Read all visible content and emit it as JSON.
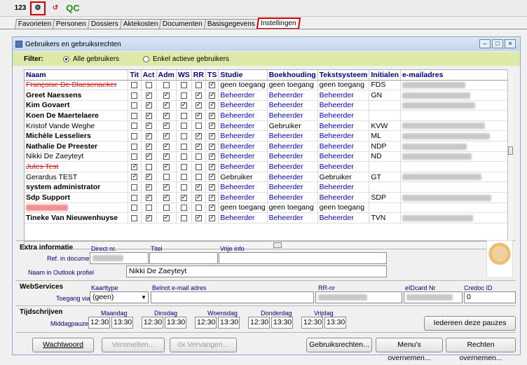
{
  "toolbar": {
    "buttons": [
      {
        "name": "numbering-icon",
        "label": "123"
      },
      {
        "name": "users-settings-icon",
        "label": "⚙"
      },
      {
        "name": "arrow-icon",
        "label": "↺"
      },
      {
        "name": "qc-icon",
        "label": "QC"
      }
    ]
  },
  "tabs": [
    "Favorieten",
    "Personen",
    "Dossiers",
    "Aktekosten",
    "Documenten",
    "Basisgegevens",
    "Instellingen"
  ],
  "window": {
    "title": "Gebruikers en gebruiksrechten"
  },
  "filter": {
    "label": "Filter:",
    "option_all": "Alle gebruikers",
    "option_active": "Enkel actieve gebruikers"
  },
  "table": {
    "headers": [
      "Naam",
      "Tit",
      "Act",
      "Adm",
      "WS",
      "RR",
      "TS",
      "Studie",
      "Boekhouding",
      "Tekstsysteem",
      "Initialen",
      "e-mailadres"
    ],
    "rows": [
      {
        "name": "Françoise De Blaesenaeker",
        "style": "strike",
        "tit": false,
        "act": false,
        "adm": false,
        "ws": false,
        "rr": false,
        "ts": true,
        "studie": "geen toegang",
        "boek": "geen toegang",
        "tekst": "geen toegang",
        "init": "FDS",
        "email": true
      },
      {
        "name": "Greet Naessens",
        "style": "bold",
        "tit": false,
        "act": true,
        "adm": true,
        "ws": false,
        "rr": true,
        "ts": true,
        "studie": "Beheerder",
        "boek": "Beheerder",
        "tekst": "Beheerder",
        "init": "GN",
        "email": true
      },
      {
        "name": "Kim Govaert",
        "style": "bold",
        "tit": false,
        "act": true,
        "adm": true,
        "ws": true,
        "rr": true,
        "ts": true,
        "studie": "Beheerder",
        "boek": "Beheerder",
        "tekst": "Beheerder",
        "init": "",
        "email": true
      },
      {
        "name": "Koen De Maertelaere",
        "style": "bold",
        "tit": false,
        "act": true,
        "adm": true,
        "ws": false,
        "rr": true,
        "ts": true,
        "studie": "Beheerder",
        "boek": "Beheerder",
        "tekst": "Beheerder",
        "init": "",
        "email": false
      },
      {
        "name": "Kristof Vande Weghe",
        "style": "normal",
        "tit": false,
        "act": true,
        "adm": true,
        "ws": false,
        "rr": false,
        "ts": true,
        "studie": "Beheerder",
        "boek": "Gebruiker",
        "tekst": "Beheerder",
        "init": "KVW",
        "email": true
      },
      {
        "name": "Michèle Lesseliers",
        "style": "bold",
        "tit": false,
        "act": true,
        "adm": true,
        "ws": false,
        "rr": true,
        "ts": true,
        "studie": "Beheerder",
        "boek": "Beheerder",
        "tekst": "Beheerder",
        "init": "ML",
        "email": true
      },
      {
        "name": "Nathalie De Preester",
        "style": "bold",
        "tit": false,
        "act": true,
        "adm": true,
        "ws": false,
        "rr": true,
        "ts": true,
        "studie": "Beheerder",
        "boek": "Beheerder",
        "tekst": "Beheerder",
        "init": "NDP",
        "email": true
      },
      {
        "name": "Nikki De Zaeyteyt",
        "style": "normal",
        "tit": false,
        "act": true,
        "adm": true,
        "ws": false,
        "rr": false,
        "ts": true,
        "studie": "Beheerder",
        "boek": "Beheerder",
        "tekst": "Beheerder",
        "init": "ND",
        "email": true
      },
      {
        "name": "Jules Test",
        "style": "strike",
        "tit": true,
        "act": false,
        "adm": true,
        "ws": false,
        "rr": false,
        "ts": true,
        "studie": "Beheerder",
        "boek": "Beheerder",
        "tekst": "Beheerder",
        "init": "",
        "email": false
      },
      {
        "name": "Gerardus TEST",
        "style": "normal",
        "tit": true,
        "act": true,
        "adm": false,
        "ws": false,
        "rr": false,
        "ts": true,
        "studie": "Gebruiker",
        "boek": "Beheerder",
        "tekst": "Gebruiker",
        "init": "GT",
        "email": true
      },
      {
        "name": "system administrator",
        "style": "bold",
        "tit": false,
        "act": true,
        "adm": true,
        "ws": false,
        "rr": true,
        "ts": true,
        "studie": "Beheerder",
        "boek": "Beheerder",
        "tekst": "Beheerder",
        "init": "",
        "email": false
      },
      {
        "name": "Sdp Support",
        "style": "bold",
        "tit": false,
        "act": true,
        "adm": true,
        "ws": true,
        "rr": true,
        "ts": true,
        "studie": "Beheerder",
        "boek": "Beheerder",
        "tekst": "Beheerder",
        "init": "SDP",
        "email": true
      },
      {
        "name": "Redacted",
        "style": "strike",
        "tit": false,
        "act": false,
        "adm": false,
        "ws": false,
        "rr": false,
        "ts": true,
        "studie": "geen toegang",
        "boek": "geen toegang",
        "tekst": "geen toegang",
        "init": "",
        "email": false
      },
      {
        "name": "Tineke Van Nieuwenhuyse",
        "style": "bold",
        "tit": false,
        "act": true,
        "adm": true,
        "ws": false,
        "rr": true,
        "ts": true,
        "studie": "Beheerder",
        "boek": "Beheerder",
        "tekst": "Beheerder",
        "init": "TVN",
        "email": true
      }
    ]
  },
  "extra": {
    "title": "Extra informatie",
    "ref_label": "Ref. in documenten",
    "outlook_label": "Naam in Outlook profiel",
    "direct_label": "Direct nr.",
    "titel_label": "Titel",
    "vrije_label": "Vrije info",
    "outlook_value": "Nikki De Zaeyteyt"
  },
  "webservices": {
    "title": "WebServices",
    "toegang_label": "Toegang via",
    "kaarttype_label": "Kaarttype",
    "kaarttype_value": "(geen)",
    "email_label": "Belnot e-mail adres",
    "rr_label": "RR-nr",
    "eid_label": "eIDcard Nr",
    "credoc_label": "Credoc ID",
    "credoc_value": "0"
  },
  "tijd": {
    "title": "Tijdschrijven",
    "pauzes_label": "Middagpauzes",
    "days": [
      {
        "name": "Maandag",
        "from": "12:30",
        "to": "13:30"
      },
      {
        "name": "Dinsdag",
        "from": "12:30",
        "to": "13:30"
      },
      {
        "name": "Woensdag",
        "from": "12:30",
        "to": "13:30"
      },
      {
        "name": "Donderdag",
        "from": "12:30",
        "to": "13:30"
      },
      {
        "name": "Vrijdag",
        "from": "12:30",
        "to": "13:30"
      }
    ],
    "all_button": "Iedereen deze pauzes"
  },
  "buttons": {
    "wachtwoord": "Wachtwoord",
    "versmelten": "Versmelten...",
    "vervangen": "0x Vervangen...",
    "rechten": "Gebruiksrechten...",
    "menus": "Menu's overnemen...",
    "rechten_overnemen": "Rechten overnemen..."
  }
}
